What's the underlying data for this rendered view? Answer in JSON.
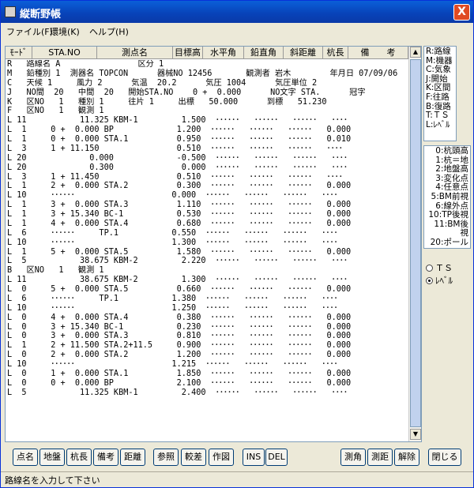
{
  "window": {
    "title": "縦断野帳",
    "close": "X"
  },
  "menu": [
    "ファイル(F)",
    "環境(K)",
    "ヘルプ(H)"
  ],
  "columns": [
    "ﾓｰﾄﾞ",
    "STA.NO",
    "測点名",
    "目標高",
    "水平角",
    "鉛直角",
    "斜距離",
    "杭長",
    "備　　考"
  ],
  "rows": [
    "R   路線名 A                区分 1",
    "M   鉛種別 1  測器名 TOPCON      器械NO 12456       観測者 岩木        年月日 07/09/06",
    "C   天候 1     風力 2      気温  20.2      気圧 1004      気圧単位 2",
    "J   NO間  20   中間  20   開始STA.NO    0 +  0.000      NO文字 STA.      冠字",
    "K   区NO   1   種別 1     往片 1     出標   50.000      到標   51.230",
    "F   区NO   1   観測 1",
    "L 11           11.325 KBM-1         1.500  ･･････   ･･････   ･･････   ････",
    "L  1     0 +  0.000 BP             1.200  ･･････   ･･････   ･･････   0.000",
    "L  1     0 +  0.000 STA.1          0.950  ･･････   ･･････   ･･････   0.010",
    "L  3     1 + 11.150                0.510  ･･････   ･･････   ･･････   ････",
    "L 20             0.000             -0.500  ･･････   ･･････   ･･････   ････",
    "L 20             0.300              0.000  ･･････   ･･････   ･･････   ････",
    "L  3     1 + 11.450                0.510  ･･････   ･･････   ･･････   ････",
    "L  1     2 +  0.000 STA.2          0.300  ･･････   ･･････   ･･････   0.000",
    "L 10     ･･････                    0.000  ･･････   ･･････   ･･････   ････",
    "L  1     3 +  0.000 STA.3          1.110  ･･････   ･･････   ･･････   0.000",
    "L  1     3 + 15.340 BC-1           0.530  ･･････   ･･････   ･･････   0.000",
    "L  1     4 +  0.000 STA.4          0.680  ･･････   ･･････   ･･････   0.000",
    "L  6     ･･････     TP.1           0.550  ･･････   ･･････   ･･････   ････",
    "L 10     ･･････                    1.300  ･･････   ･･････   ･･････   ････",
    "L  1     5 +  0.000 STA.5          1.580  ･･････   ･･････   ･･････   0.000",
    "L  5           38.675 KBM-2         2.220  ･･････   ･･････   ･･････   ････",
    "B   区NO   1   観測 1",
    "L 11           38.675 KBM-2         1.300  ･･････   ･･････   ･･････   ････",
    "L  0     5 +  0.000 STA.5          0.660  ･･････   ･･････   ･･････   0.000",
    "L  6     ･･････     TP.1           1.380  ･･････   ･･････   ･･････   ････",
    "L 10     ･･････                    1.250  ･･････   ･･････   ･･････   ････",
    "L  0     4 +  0.000 STA.4          0.380  ･･････   ･･････   ･･････   0.000",
    "L  0     3 + 15.340 BC-1           0.230  ･･････   ･･････   ･･････   0.000",
    "L  0     3 +  0.000 STA.3          0.810  ･･････   ･･････   ･･････   0.000",
    "L  1     2 + 11.500 STA.2+11.5     0.900  ･･････   ･･････   ･･････   0.000",
    "L  0     2 +  0.000 STA.2          1.200  ･･････   ･･････   ･･････   0.000",
    "L 10     ･･････                    1.215  ･･････   ･･････   ･･････   ････",
    "L  0     1 +  0.000 STA.1          1.850  ･･････   ･･････   ･･････   0.000",
    "L  0     0 +  0.000 BP             2.100  ･･････   ･･････   ･･････   0.000",
    "L  5           11.325 KBM-1         2.400  ･･････   ･･････   ･･････   ････"
  ],
  "legend_modes": [
    "R:路線",
    "M:機器",
    "C:気象",
    "J:開始",
    "K:区間",
    "F:往路",
    "B:復路",
    "T:ＴＳ",
    "L:ﾚﾍﾞﾙ"
  ],
  "legend_codes": [
    "0:杭頭高",
    "1:杭＝地",
    "2:地盤高",
    "3:変化点",
    "4:任意点",
    "5:BM前視",
    "6:線外点",
    "10:TP後視",
    "11:BM後視",
    "20:ポール"
  ],
  "radio": {
    "ts": "ＴＳ",
    "level": "ﾚﾍﾞﾙ",
    "selected": "level"
  },
  "buttons": [
    "点名",
    "地盤",
    "杭長",
    "備考",
    "距離",
    "参照",
    "較差",
    "作図",
    "INS",
    "DEL",
    "測角",
    "測距",
    "解除",
    "閉じる"
  ],
  "status": "路線名を入力して下さい"
}
